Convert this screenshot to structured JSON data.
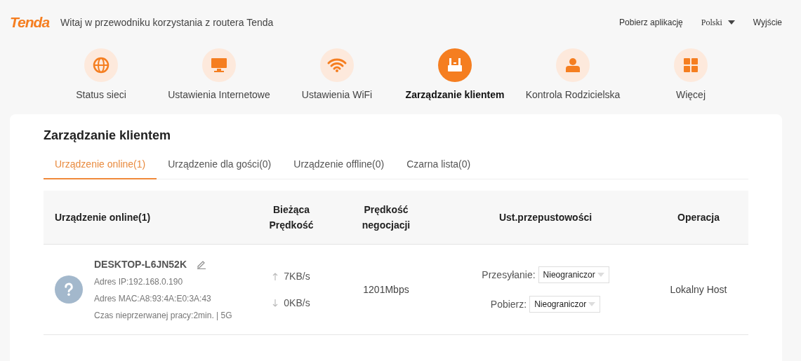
{
  "header": {
    "logo": "Tenda",
    "welcome": "Witaj w przewodniku korzystania z routera Tenda",
    "links": [
      {
        "kind": "link",
        "label": "Pobierz aplikację"
      },
      {
        "kind": "language",
        "label": "Polski"
      },
      {
        "kind": "link",
        "label": "Wyjście"
      }
    ]
  },
  "nav": [
    {
      "kind": "globe",
      "label": "Status sieci",
      "selected": false
    },
    {
      "kind": "monitor",
      "label": "Ustawienia Internetowe",
      "selected": false
    },
    {
      "kind": "wifi",
      "label": "Ustawienia WiFi",
      "selected": false
    },
    {
      "kind": "router",
      "label": "Zarządzanie klientem",
      "selected": true
    },
    {
      "kind": "person",
      "label": "Kontrola Rodzicielska",
      "selected": false
    },
    {
      "kind": "grid",
      "label": "Więcej",
      "selected": false
    }
  ],
  "page_title": "Zarządzanie klientem",
  "tabs": [
    {
      "label": "Urządzenie online(1)",
      "selected": true
    },
    {
      "label": "Urządzenie dla gości(0)",
      "selected": false
    },
    {
      "label": "Urządzenie offline(0)",
      "selected": false
    },
    {
      "label": "Czarna lista(0)",
      "selected": false
    }
  ],
  "table": {
    "columns": [
      "Urządzenie online(1)",
      "Bieżąca Prędkość",
      "Prędkość negocjacji",
      "Ust.przepustowości",
      "Operacja"
    ],
    "rows": [
      {
        "name": "DESKTOP-L6JN52K",
        "ip": "Adres IP:192.168.0.190",
        "mac": "Adres MAC:A8:93:4A:E0:3A:43",
        "uptime": "Czas nieprzerwanej pracy:2min. | 5G",
        "up": "7KB/s",
        "down": "0KB/s",
        "negotiated": "1201Mbps",
        "limits": [
          {
            "label": "Przesyłanie:",
            "value": "Nieograniczor"
          },
          {
            "label": "Pobierz:",
            "value": "Nieograniczor"
          }
        ],
        "operation": "Lokalny Host"
      }
    ]
  }
}
